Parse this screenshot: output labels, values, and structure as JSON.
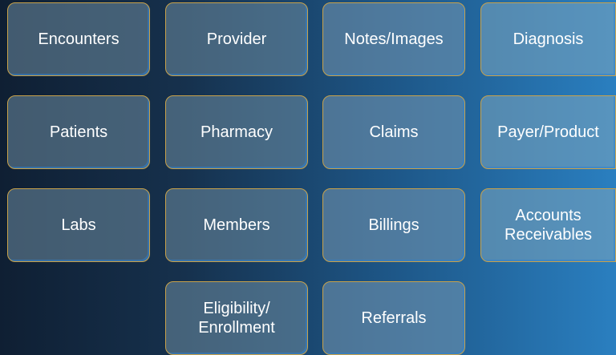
{
  "tiles": [
    {
      "label": "Encounters"
    },
    {
      "label": "Provider"
    },
    {
      "label": "Notes/Images"
    },
    {
      "label": "Diagnosis"
    },
    {
      "label": "Patients"
    },
    {
      "label": "Pharmacy"
    },
    {
      "label": "Claims"
    },
    {
      "label": "Payer/Product"
    },
    {
      "label": "Labs"
    },
    {
      "label": "Members"
    },
    {
      "label": "Billings"
    },
    {
      "label": "Accounts\nReceivables"
    },
    {
      "label": "Eligibility/\nEnrollment"
    },
    {
      "label": "Referrals"
    }
  ]
}
